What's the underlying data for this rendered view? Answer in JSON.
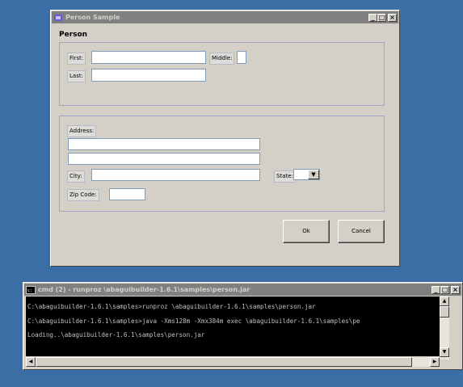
{
  "person_window": {
    "title": "Person Sample",
    "heading": "Person",
    "labels": {
      "first": "First:",
      "middle": "Middle:",
      "last": "Last:",
      "address": "Address:",
      "city": "City:",
      "state": "State:",
      "zip": "Zip Code:"
    },
    "fields": {
      "first": "",
      "middle": "",
      "last": "",
      "address1": "",
      "address2": "",
      "city": "",
      "state": "",
      "zip": ""
    },
    "buttons": {
      "ok": "Ok",
      "cancel": "Cancel"
    }
  },
  "cmd_window": {
    "title": "cmd (2) - runproz \\abaguibuilder-1.6.1\\samples\\person.jar",
    "lines": [
      "C:\\abaguibuilder-1.6.1\\samples>runproz \\abaguibuilder-1.6.1\\samples\\person.jar",
      "C:\\abaguibuilder-1.6.1\\samples>java -Xms128m -Xmx384m exec \\abaguibuilder-1.6.1\\samples\\pe",
      "Loading..\\abaguibuilder-1.6.1\\samples\\person.jar"
    ]
  },
  "window_controls": {
    "minimize": "_",
    "maximize": "□",
    "close": "×"
  },
  "colors": {
    "desktop": "#3a6ea5",
    "inactive_titlebar": "#808080",
    "console_bg": "#000000"
  }
}
